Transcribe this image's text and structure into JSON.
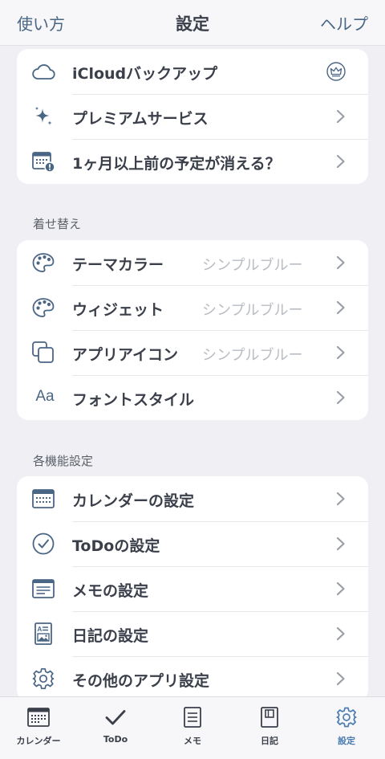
{
  "header": {
    "left_label": "使い方",
    "title": "設定",
    "right_label": "ヘルプ"
  },
  "group1": {
    "items": [
      {
        "label": "iCloudバックアップ"
      },
      {
        "label": "プレミアムサービス"
      },
      {
        "label": "1ヶ月以上前の予定が消える？"
      }
    ]
  },
  "section_theme": {
    "title": "着せ替え"
  },
  "group2": {
    "items": [
      {
        "label": "テーマカラー",
        "value": "シンプルブルー"
      },
      {
        "label": "ウィジェット",
        "value": "シンプルブルー"
      },
      {
        "label": "アプリアイコン",
        "value": "シンプルブルー"
      },
      {
        "label": "フォントスタイル",
        "icon_text": "Aa"
      }
    ]
  },
  "section_features": {
    "title": "各機能設定"
  },
  "group3": {
    "items": [
      {
        "label": "カレンダーの設定"
      },
      {
        "label": "ToDoの設定"
      },
      {
        "label": "メモの設定"
      },
      {
        "label": "日記の設定"
      },
      {
        "label": "その他のアプリ設定"
      }
    ]
  },
  "tabbar": {
    "tabs": [
      {
        "label": "カレンダー"
      },
      {
        "label": "ToDo"
      },
      {
        "label": "メモ"
      },
      {
        "label": "日記"
      },
      {
        "label": "設定",
        "active": true
      }
    ]
  },
  "colors": {
    "accent": "#4a7bb0",
    "icon": "#4a6685",
    "text": "#3a3f4a",
    "value": "#b9bcc3",
    "background": "#f0f0f4"
  }
}
